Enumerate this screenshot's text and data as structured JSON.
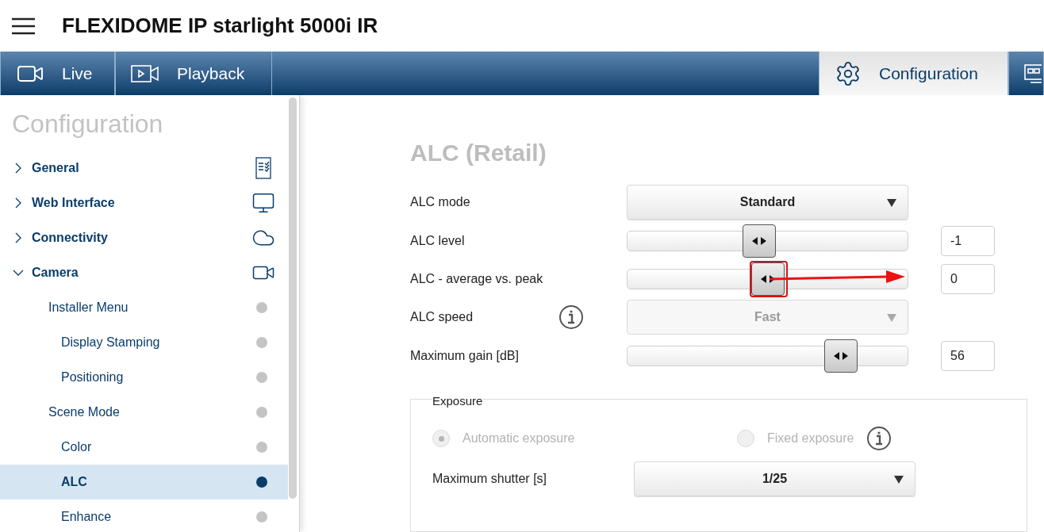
{
  "header": {
    "title": "FLEXIDOME IP starlight 5000i IR"
  },
  "nav_tabs": [
    {
      "kind": "live",
      "label": "Live",
      "selected": false
    },
    {
      "kind": "playback",
      "label": "Playback",
      "selected": false
    },
    {
      "kind": "configuration",
      "label": "Configuration",
      "selected": true
    },
    {
      "kind": "monitor",
      "selected": false
    }
  ],
  "sidebar": {
    "title": "Configuration",
    "items": [
      {
        "label": "General",
        "expanded": false,
        "selected": false
      },
      {
        "label": "Web Interface",
        "expanded": false,
        "selected": false
      },
      {
        "label": "Connectivity",
        "expanded": false,
        "selected": false
      },
      {
        "label": "Camera",
        "expanded": true,
        "selected": false,
        "children": [
          {
            "label": "Installer Menu",
            "selected": false,
            "children": [
              {
                "label": "Display Stamping",
                "selected": false
              },
              {
                "label": "Positioning",
                "selected": false
              }
            ]
          },
          {
            "label": "Scene Mode",
            "selected": false,
            "children": [
              {
                "label": "Color",
                "selected": false
              },
              {
                "label": "ALC",
                "selected": true
              },
              {
                "label": "Enhance",
                "selected": false
              }
            ]
          }
        ]
      }
    ]
  },
  "main": {
    "title": "ALC (Retail)",
    "settings": [
      {
        "kind": "select",
        "label": "ALC mode",
        "value": "Standard",
        "disabled": false
      },
      {
        "kind": "slider",
        "label": "ALC level",
        "level": 0.47,
        "value": "-1"
      },
      {
        "kind": "slider",
        "label": "ALC - average vs. peak",
        "level": 0.5,
        "value": "0",
        "highlighted": true
      },
      {
        "kind": "select",
        "label": "ALC speed",
        "value": "Fast",
        "disabled": true,
        "info": true
      },
      {
        "kind": "slider",
        "label": "Maximum gain [dB]",
        "level": 0.76,
        "value": "56"
      }
    ],
    "exposure": {
      "legend": "Exposure",
      "disabled": true,
      "options": [
        {
          "label": "Automatic exposure",
          "selected": true
        },
        {
          "label": "Fixed exposure",
          "selected": false,
          "info": true
        }
      ],
      "settings": [
        {
          "kind": "select",
          "label": "Maximum shutter [s]",
          "value": "1/25",
          "disabled": false
        }
      ]
    }
  }
}
